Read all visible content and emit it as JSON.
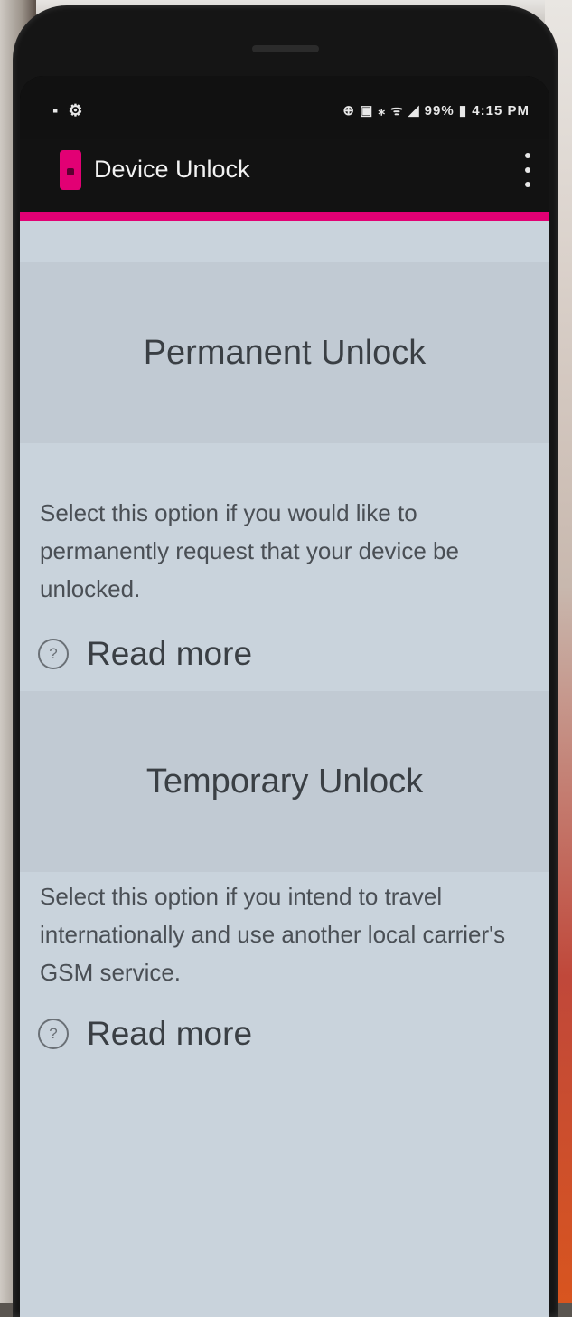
{
  "status_bar": {
    "left_icons": "▪ ⚙",
    "right_text": "⊕ ▣ ⁎ ᯤ ◢ 99% ▮ 4:15 PM"
  },
  "app_bar": {
    "title": "Device Unlock",
    "icon": "t-mobile-app-icon",
    "menu_icon": "overflow-menu-icon"
  },
  "options": [
    {
      "title": "Permanent Unlock",
      "description": "Select this option if you would like to permanently request that your device be unlocked.",
      "read_more": "Read more",
      "info_icon": "?"
    },
    {
      "title": "Temporary Unlock",
      "description": "Select this option if you intend to travel internationally and use another local carrier's GSM service.",
      "read_more": "Read more",
      "info_icon": "?"
    }
  ],
  "colors": {
    "accent": "#e20074",
    "content_bg": "#c9d3dc",
    "header_bg": "#c1cad3"
  }
}
